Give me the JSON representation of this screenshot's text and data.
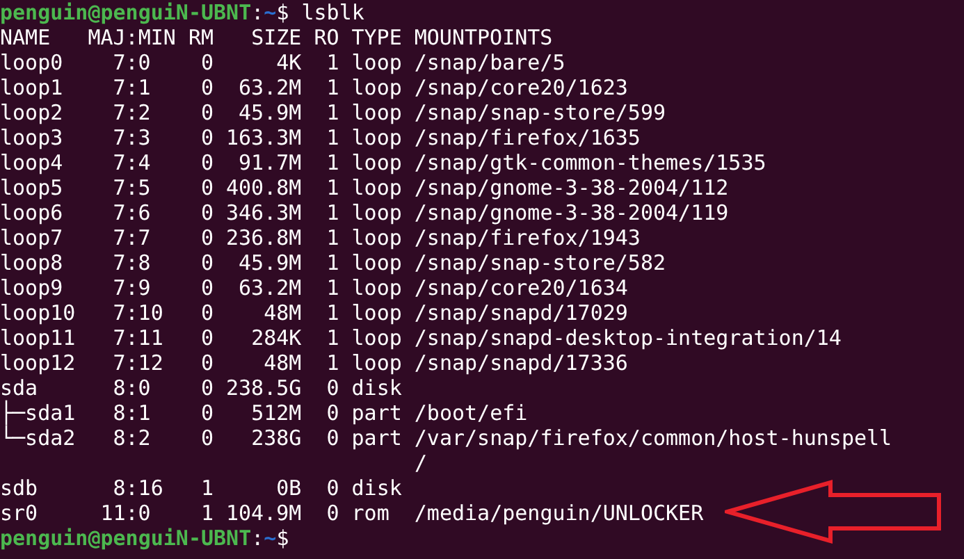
{
  "prompt_top": {
    "user_host": "penguin@penguiN-UBNT",
    "separator": ":",
    "path": "~",
    "symbol": "$",
    "command": "lsblk"
  },
  "columns": [
    "NAME",
    "MAJ:MIN",
    "RM",
    "SIZE",
    "RO",
    "TYPE",
    "MOUNTPOINTS"
  ],
  "rows": [
    {
      "name": "loop0",
      "maj_min": "7:0",
      "rm": "0",
      "size": "4K",
      "ro": "1",
      "type": "loop",
      "mountpoint": "/snap/bare/5"
    },
    {
      "name": "loop1",
      "maj_min": "7:1",
      "rm": "0",
      "size": "63.2M",
      "ro": "1",
      "type": "loop",
      "mountpoint": "/snap/core20/1623"
    },
    {
      "name": "loop2",
      "maj_min": "7:2",
      "rm": "0",
      "size": "45.9M",
      "ro": "1",
      "type": "loop",
      "mountpoint": "/snap/snap-store/599"
    },
    {
      "name": "loop3",
      "maj_min": "7:3",
      "rm": "0",
      "size": "163.3M",
      "ro": "1",
      "type": "loop",
      "mountpoint": "/snap/firefox/1635"
    },
    {
      "name": "loop4",
      "maj_min": "7:4",
      "rm": "0",
      "size": "91.7M",
      "ro": "1",
      "type": "loop",
      "mountpoint": "/snap/gtk-common-themes/1535"
    },
    {
      "name": "loop5",
      "maj_min": "7:5",
      "rm": "0",
      "size": "400.8M",
      "ro": "1",
      "type": "loop",
      "mountpoint": "/snap/gnome-3-38-2004/112"
    },
    {
      "name": "loop6",
      "maj_min": "7:6",
      "rm": "0",
      "size": "346.3M",
      "ro": "1",
      "type": "loop",
      "mountpoint": "/snap/gnome-3-38-2004/119"
    },
    {
      "name": "loop7",
      "maj_min": "7:7",
      "rm": "0",
      "size": "236.8M",
      "ro": "1",
      "type": "loop",
      "mountpoint": "/snap/firefox/1943"
    },
    {
      "name": "loop8",
      "maj_min": "7:8",
      "rm": "0",
      "size": "45.9M",
      "ro": "1",
      "type": "loop",
      "mountpoint": "/snap/snap-store/582"
    },
    {
      "name": "loop9",
      "maj_min": "7:9",
      "rm": "0",
      "size": "63.2M",
      "ro": "1",
      "type": "loop",
      "mountpoint": "/snap/core20/1634"
    },
    {
      "name": "loop10",
      "maj_min": "7:10",
      "rm": "0",
      "size": "48M",
      "ro": "1",
      "type": "loop",
      "mountpoint": "/snap/snapd/17029"
    },
    {
      "name": "loop11",
      "maj_min": "7:11",
      "rm": "0",
      "size": "284K",
      "ro": "1",
      "type": "loop",
      "mountpoint": "/snap/snapd-desktop-integration/14"
    },
    {
      "name": "loop12",
      "maj_min": "7:12",
      "rm": "0",
      "size": "48M",
      "ro": "1",
      "type": "loop",
      "mountpoint": "/snap/snapd/17336"
    },
    {
      "name": "sda",
      "maj_min": "8:0",
      "rm": "0",
      "size": "238.5G",
      "ro": "0",
      "type": "disk"
    },
    {
      "name": "├─sda1",
      "maj_min": "8:1",
      "rm": "0",
      "size": "512M",
      "ro": "0",
      "type": "part",
      "mountpoint": "/boot/efi"
    },
    {
      "name": "└─sda2",
      "maj_min": "8:2",
      "rm": "0",
      "size": "238G",
      "ro": "0",
      "type": "part",
      "mountpoint": "/var/snap/firefox/common/host-hunspell",
      "mountpoint_wrap": "/"
    },
    {
      "name": "sdb",
      "maj_min": "8:16",
      "rm": "1",
      "size": "0B",
      "ro": "0",
      "type": "disk"
    },
    {
      "name": "sr0",
      "maj_min": "11:0",
      "rm": "1",
      "size": "104.9M",
      "ro": "0",
      "type": "rom",
      "mountpoint": "/media/penguin/UNLOCKER"
    }
  ],
  "prompt_bottom": {
    "user_host": "penguin@penguiN-UBNT",
    "separator": ":",
    "path": "~",
    "symbol": "$"
  }
}
